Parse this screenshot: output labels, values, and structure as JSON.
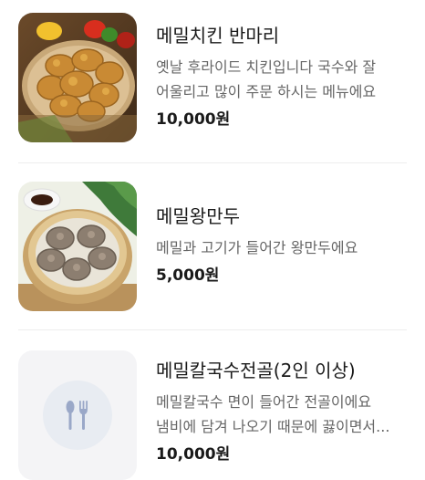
{
  "menu": {
    "items": [
      {
        "name": "메밀치킨 반마리",
        "description_lines": [
          "옛날 후라이드 치킨입니다 국수와 잘",
          "어울리고 많이 주문 하시는 메뉴에요"
        ],
        "price": "10,000원",
        "image": "fried-chicken-photo"
      },
      {
        "name": "메밀왕만두",
        "description_lines": [
          "메밀과 고기가 들어간 왕만두에요"
        ],
        "price": "5,000원",
        "image": "dumplings-in-steamer-photo"
      },
      {
        "name": "메밀칼국수전골(2인 이상)",
        "description_lines": [
          "메밀칼국수 면이 들어간 전골이에요",
          "냄비에 담겨 나오기 때문에 끓이면서..."
        ],
        "price": "10,000원",
        "image": "fork-spoon-icon"
      }
    ]
  },
  "colors": {
    "title": "#1a1a1a",
    "description": "#666666",
    "divider": "#eeeeee",
    "placeholder_bg": "#f4f4f6",
    "placeholder_circle": "#e8ecf2",
    "utensil_icon": "#9aa8c8"
  }
}
